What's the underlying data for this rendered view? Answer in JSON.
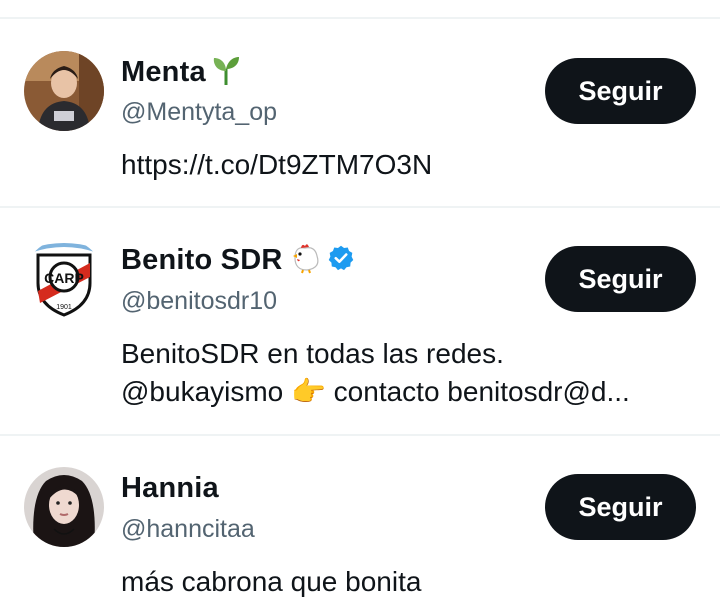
{
  "colors": {
    "text": "#0f1419",
    "secondary": "#536471",
    "divider": "#eff3f4",
    "button_bg": "#0f1419",
    "button_text": "#ffffff",
    "verified": "#1d9bf0"
  },
  "users": [
    {
      "name": "Menta",
      "emoji": "seedling-icon",
      "handle": "@Mentyta_op",
      "bio": [
        "https://t.co/Dt9ZTM7O3N"
      ],
      "follow_label": "Seguir",
      "verified": false
    },
    {
      "name": "Benito SDR",
      "emoji": "chicken-icon",
      "handle": "@benitosdr10",
      "bio": [
        "BenitoSDR en todas las redes.",
        "@bukayismo  👉 contacto benitosdr@d..."
      ],
      "follow_label": "Seguir",
      "verified": true,
      "avatar_text": "1901"
    },
    {
      "name": "Hannia",
      "handle": "@hanncitaa",
      "bio": [
        "más cabrona que bonita"
      ],
      "follow_label": "Seguir",
      "verified": false
    }
  ]
}
